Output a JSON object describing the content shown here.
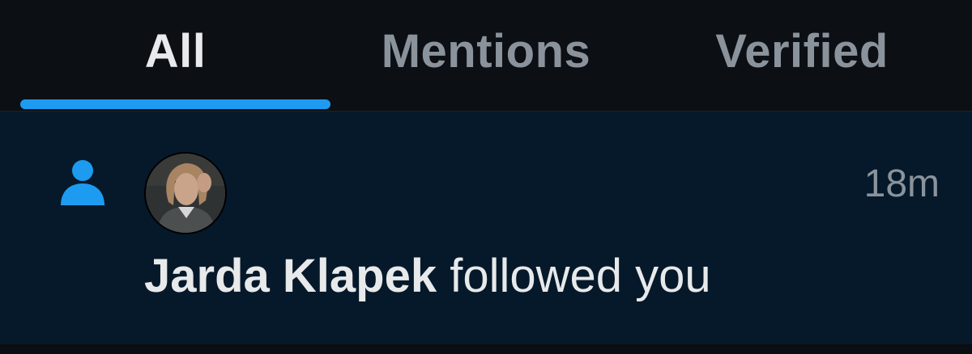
{
  "tabs": [
    {
      "label": "All",
      "active": true
    },
    {
      "label": "Mentions",
      "active": false
    },
    {
      "label": "Verified",
      "active": false
    }
  ],
  "notification": {
    "type_icon": "person-follow-icon",
    "avatar_alt": "Jarda Klapek avatar",
    "timestamp": "18m",
    "user_name": "Jarda Klapek",
    "action_text": " followed you"
  },
  "colors": {
    "accent": "#1d9bf0",
    "notification_bg": "#06192a",
    "tab_bg": "#0c0f13",
    "text_primary": "#e7e9ea",
    "text_secondary": "#8a939c"
  }
}
